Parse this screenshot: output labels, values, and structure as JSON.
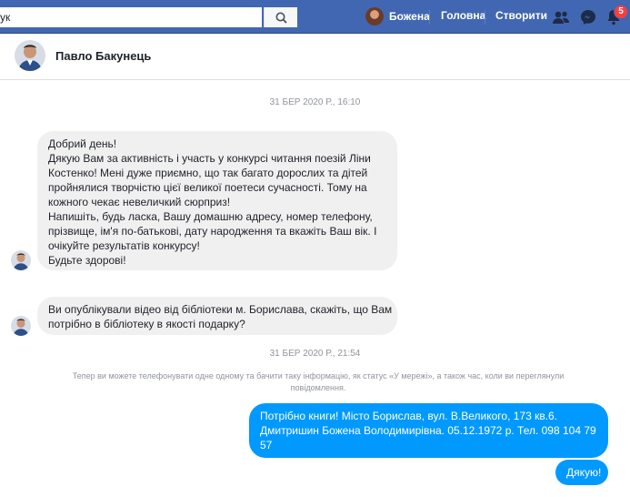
{
  "topbar": {
    "search": {
      "value": "ук",
      "placeholder": ""
    },
    "profile_name": "Божена",
    "home_label": "Головна",
    "create_label": "Створити",
    "notifications_count": "5",
    "colors": {
      "bar": "#4267b2"
    }
  },
  "conversation": {
    "contact_name": "Павло Бакунець"
  },
  "messages": {
    "timestamp_1": "31 БЕР 2020 Р., 16:10",
    "incoming_1": [
      "Добрий день!",
      "Дякую Вам за активність і участь у конкурсі читання поезій Ліни",
      "Костенко! Мені дуже приємно, що так багато дорослих та дітей",
      "пройнялися творчістю цієї великої поетеси сучасності. Тому на",
      "кожного чекає невеличкий сюрприз!",
      "Напишіть, будь ласка, Вашу домашню адресу, номер телефону,",
      "прізвище, ім'я по-батькові, дату народження та вкажіть Ваш вік. І",
      "очікуйте результатів конкурсу!",
      "Будьте здорові!"
    ],
    "incoming_2": [
      "Ви опублікували відео від бібліотеки м. Борислава, скажіть, що Вам",
      "потрібно в бібліотеку в якості подарку?"
    ],
    "timestamp_2": "31 БЕР 2020 Р., 21:54",
    "notice": [
      "Тепер ви можете телефонувати одне одному та бачити таку інформацію, як статус «У мережі», а також час, коли ви переглянули",
      "повідомлення."
    ],
    "outgoing_1": [
      "Потрібно книги! Місто Борислав, вул. В.Великого, 173 кв.6.",
      "Дмитришин Божена Володимирівна. 05.12.1972 р. Тел. 098 104 79",
      "57"
    ],
    "outgoing_2": "Дякую!",
    "colors": {
      "incoming": "#f1f0f0",
      "outgoing": "#0099ff"
    }
  }
}
